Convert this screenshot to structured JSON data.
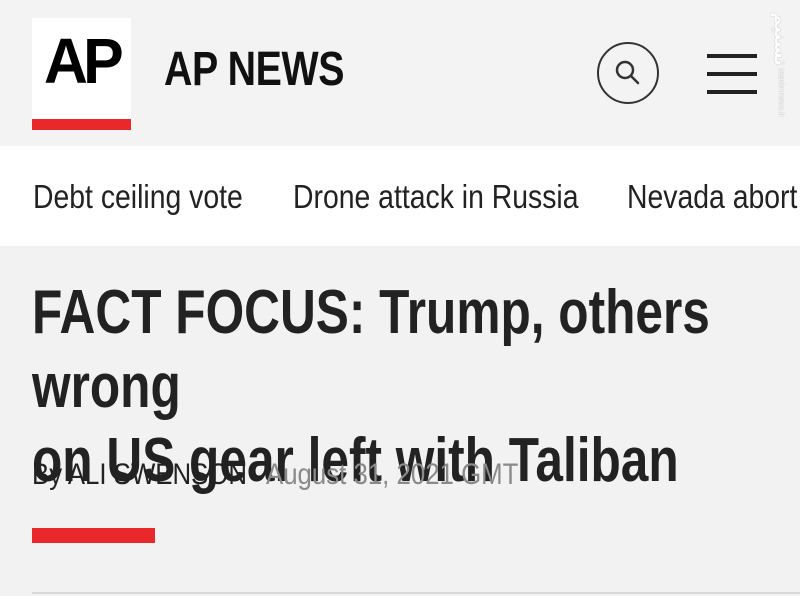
{
  "header": {
    "logo_text": "AP",
    "brand": "AP NEWS",
    "search_label": "Search",
    "menu_label": "Menu"
  },
  "watermark": {
    "mark": "تسنیم",
    "text": "tasnimnews.ir"
  },
  "trending": [
    {
      "label": "Debt ceiling vote"
    },
    {
      "label": "Drone attack in Russia"
    },
    {
      "label": "Nevada abort"
    }
  ],
  "article": {
    "headline_line1": "FACT FOCUS: Trump, others wrong",
    "headline_line2": "on US gear left with Taliban",
    "byline": "By ALI SWENSON",
    "date": "August 31, 2021 GMT"
  },
  "colors": {
    "accent": "#e8282b",
    "text": "#222222",
    "muted": "#8a8a8a"
  }
}
